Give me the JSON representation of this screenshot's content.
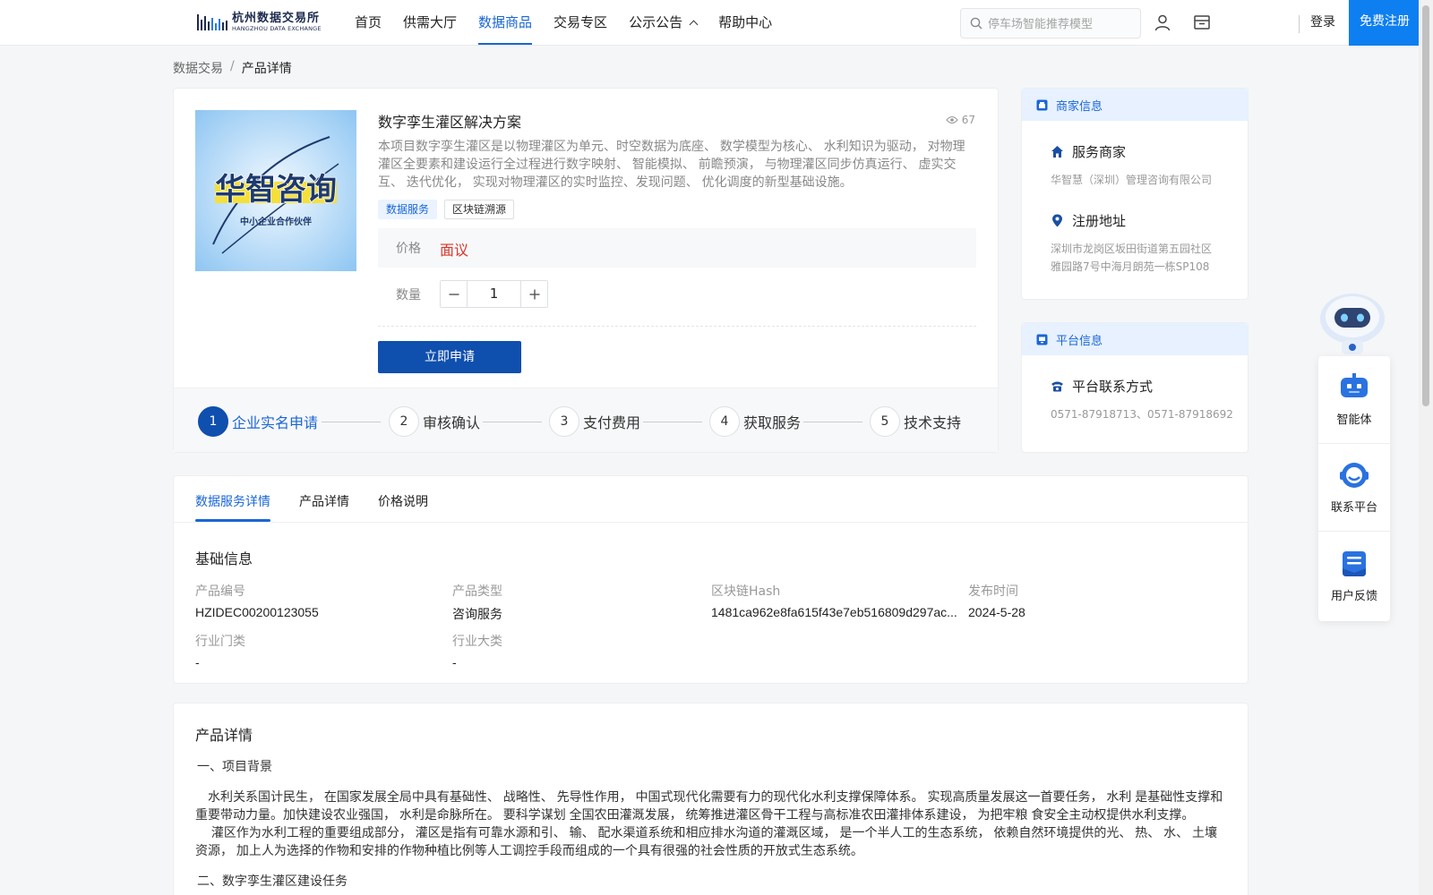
{
  "header": {
    "logo_cn": "杭州数据交易所",
    "logo_en": "HANGZHOU DATA EXCHANGE",
    "nav": [
      {
        "label": "首页"
      },
      {
        "label": "供需大厅"
      },
      {
        "label": "数据商品"
      },
      {
        "label": "交易专区"
      },
      {
        "label": "公示公告"
      },
      {
        "label": "帮助中心"
      }
    ],
    "search_placeholder": "停车场智能推荐模型",
    "login_label": "登录",
    "register_label": "免费注册"
  },
  "breadcrumb": {
    "root": "数据交易",
    "separator": "/",
    "current": "产品详情"
  },
  "product": {
    "image_text": "华智咨询",
    "image_subtext": "中小企业合作伙伴",
    "title": "数字孪生灌区解决方案",
    "views": "67",
    "description": "本项目数字孪生灌区是以物理灌区为单元、时空数据为底座、 数学模型为核心、 水利知识为驱动， 对物理灌区全要素和建设运行全过程进行数字映射、 智能模拟、 前瞻预演， 与物理灌区同步仿真运行、 虚实交互、 迭代优化， 实现对物理灌区的实时监控、发现问题、 优化调度的新型基础设施。",
    "tags": [
      "数据服务",
      "区块链溯源"
    ],
    "price_label": "价格",
    "price_value": "面议",
    "quantity_label": "数量",
    "quantity_value": "1",
    "apply_label": "立即申请",
    "steps": [
      {
        "num": "1",
        "label": "企业实名申请"
      },
      {
        "num": "2",
        "label": "审核确认"
      },
      {
        "num": "3",
        "label": "支付费用"
      },
      {
        "num": "4",
        "label": "获取服务"
      },
      {
        "num": "5",
        "label": "技术支持"
      }
    ]
  },
  "merchant": {
    "heading": "商家信息",
    "provider_label": "服务商家",
    "provider_value": "华智慧（深圳）管理咨询有限公司",
    "address_label": "注册地址",
    "address_line1": "深圳市龙岗区坂田街道第五园社区",
    "address_line2": "雅园路7号中海月朗苑一栋SP108"
  },
  "platform": {
    "heading": "平台信息",
    "contact_label": "平台联系方式",
    "contact_value": "0571-87918713、0571-87918692"
  },
  "float": {
    "agent": "智能体",
    "contact": "联系平台",
    "feedback": "用户反馈"
  },
  "tabs": [
    "数据服务详情",
    "产品详情",
    "价格说明"
  ],
  "basic_info": {
    "title": "基础信息",
    "fields": [
      {
        "label": "产品编号",
        "value": "HZIDEC00200123055"
      },
      {
        "label": "产品类型",
        "value": "咨询服务"
      },
      {
        "label": "区块链Hash",
        "value": "1481ca962e8fa615f43e7eb516809d297ac..."
      },
      {
        "label": "发布时间",
        "value": "2024-5-28"
      },
      {
        "label": "行业门类",
        "value": "-"
      },
      {
        "label": "行业大类",
        "value": "-"
      }
    ]
  },
  "detail": {
    "title": "产品详情",
    "section1": "一、项目背景",
    "para1": "　水利关系国计民生， 在国家发展全局中具有基础性、 战略性、 先导性作用， 中国式现代化需要有力的现代化水利支撑保障体系。 实现高质量发展这一首要任务， 水利 是基础性支撑和重要带动力量。加快建设农业强国， 水利是命脉所在。 要科学谋划 全国农田灌溉发展， 统筹推进灌区骨干工程与高标准农田灌排体系建设， 为把牢粮 食安全主动权提供水利支撑。",
    "para2": "　 灌区作为水利工程的重要组成部分， 灌区是指有可靠水源和引、 输、 配水渠道系统和相应排水沟道的灌溉区域， 是一个半人工的生态系统， 依赖自然环境提供的光、 热、 水、 土壤资源， 加上人为选择的作物和安排的作物种植比例等人工调控手段而组成的一个具有很强的社会性质的开放式生态系统。",
    "section2": "二、数字孪生灌区建设任务"
  }
}
